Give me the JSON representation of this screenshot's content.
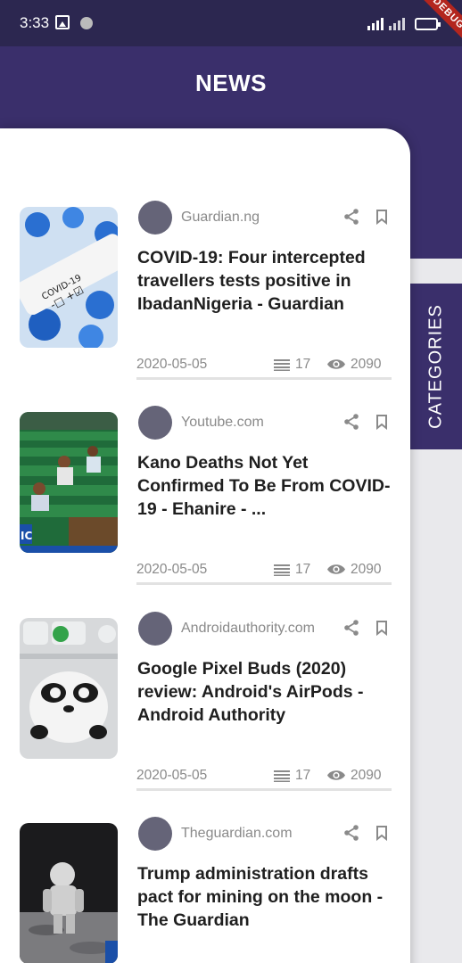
{
  "status_bar": {
    "time": "3:33",
    "network": "3G",
    "debug_banner": "DEBUG"
  },
  "header": {
    "title": "NEWS"
  },
  "categories_tab": {
    "label": "CATEGORIES"
  },
  "colors": {
    "header": "#3a2f6b",
    "status_bar": "#2c2750",
    "avatar": "#656478",
    "text_muted": "#8a8a8a"
  },
  "articles": [
    {
      "source": "Guardian.ng",
      "title": "COVID-19: Four intercepted travellers tests positive in IbadanNigeria - Guardian",
      "date": "2020-05-05",
      "count": "17",
      "views": "2090",
      "thumbnail": "covid-test-tube-photo"
    },
    {
      "source": "Youtube.com",
      "title": "Kano Deaths Not Yet Confirmed To Be From COVID-19 - Ehanire - ...",
      "date": "2020-05-05",
      "count": "17",
      "views": "2090",
      "thumbnail": "parliament-chamber-photo"
    },
    {
      "source": "Androidauthority.com",
      "title": "Google Pixel Buds (2020) review: Android's AirPods - Android Authority",
      "date": "2020-05-05",
      "count": "17",
      "views": "2090",
      "thumbnail": "earbuds-panda-photo"
    },
    {
      "source": "Theguardian.com",
      "title": "Trump administration drafts pact for mining on the moon - The Guardian",
      "date": "",
      "count": "",
      "views": "",
      "thumbnail": "astronaut-moon-photo"
    }
  ]
}
